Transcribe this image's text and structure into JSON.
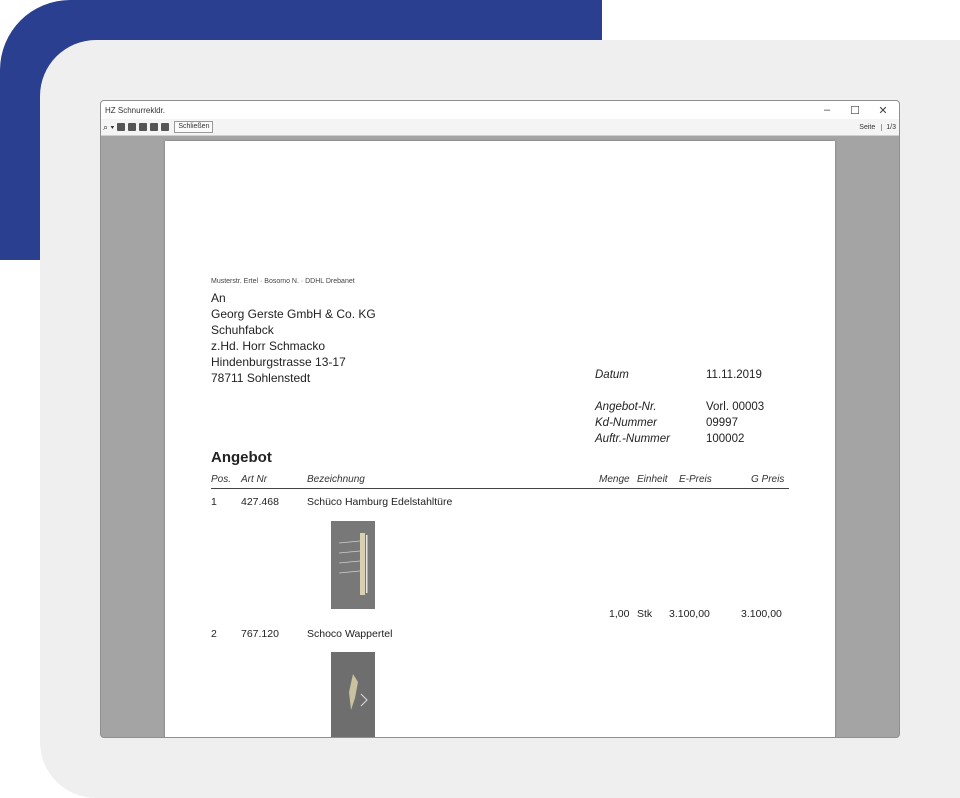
{
  "window": {
    "title": "HZ Schnurrekldr.",
    "minimize": "–",
    "maximize": "☐",
    "close": "✕"
  },
  "toolbar": {
    "search_icon": "⌕ ▾",
    "btn_label": "Schließen",
    "page_label": "Seite",
    "page_value": "1/3"
  },
  "document": {
    "sender_line": "Musterstr. Ertel · Bosomo N. · DDHL Drebanet",
    "address": [
      "An",
      "Georg Gerste GmbH & Co. KG",
      "Schuhfabck",
      "z.Hd. Horr Schmacko",
      "Hindenburgstrasse 13-17",
      "78711 Sohlenstedt"
    ],
    "meta": [
      {
        "label": "Datum",
        "value": "11.11.2019"
      },
      {
        "label": "Angebot-Nr.",
        "value": "Vorl. 00003"
      },
      {
        "label": "Kd-Nummer",
        "value": "09997"
      },
      {
        "label": "Auftr.-Nummer",
        "value": "100002"
      }
    ],
    "heading": "Angebot",
    "columns": {
      "pos": "Pos.",
      "art": "Art Nr",
      "desc": "Bezeichnung",
      "menge": "Menge",
      "einheit": "Einheit",
      "epreis": "E-Preis",
      "gpreis": "G Preis"
    },
    "items": [
      {
        "pos": "1",
        "art": "427.468",
        "desc": "Schüco Hamburg Edelstahltüre",
        "menge": "1,00",
        "einheit": "Stk",
        "epreis": "3.100,00",
        "gpreis": "3.100,00"
      },
      {
        "pos": "2",
        "art": "767.120",
        "desc": "Schoco Wappertel",
        "menge": "",
        "einheit": "",
        "epreis": "",
        "gpreis": ""
      }
    ]
  }
}
